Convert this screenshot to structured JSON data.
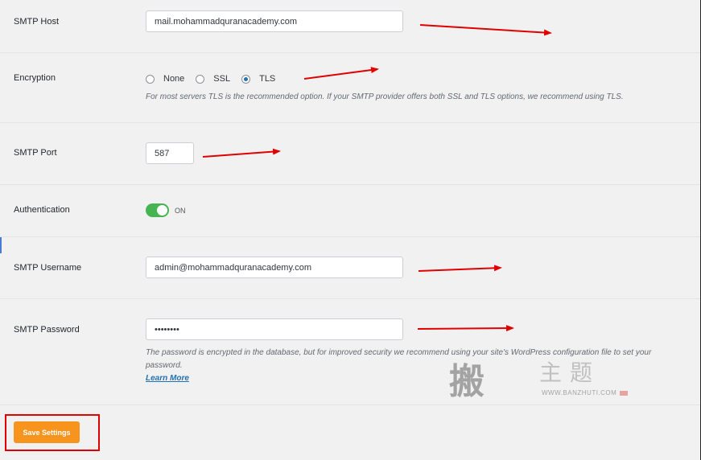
{
  "fields": {
    "smtp_host": {
      "label": "SMTP Host",
      "value": "mail.mohammadquranacademy.com"
    },
    "encryption": {
      "label": "Encryption",
      "options": [
        {
          "label": "None",
          "checked": false
        },
        {
          "label": "SSL",
          "checked": false
        },
        {
          "label": "TLS",
          "checked": true
        }
      ],
      "description": "For most servers TLS is the recommended option. If your SMTP provider offers both SSL and TLS options, we recommend using TLS."
    },
    "smtp_port": {
      "label": "SMTP Port",
      "value": "587"
    },
    "authentication": {
      "label": "Authentication",
      "state_label": "ON"
    },
    "smtp_username": {
      "label": "SMTP Username",
      "value": "admin@mohammadquranacademy.com"
    },
    "smtp_password": {
      "label": "SMTP Password",
      "value": "••••••••",
      "description": "The password is encrypted in the database, but for improved security we recommend using your site's WordPress configuration file to set your password.",
      "learn_more": "Learn More"
    }
  },
  "save_button": {
    "label": "Save Settings"
  },
  "watermark": {
    "big_char": "搬",
    "chars": "主题",
    "url": "WWW.BANZHUTI.COM"
  },
  "colors": {
    "accent": "#f7941d",
    "toggle_on": "#46b450",
    "annotation": "#e00000",
    "link": "#2271b1"
  }
}
